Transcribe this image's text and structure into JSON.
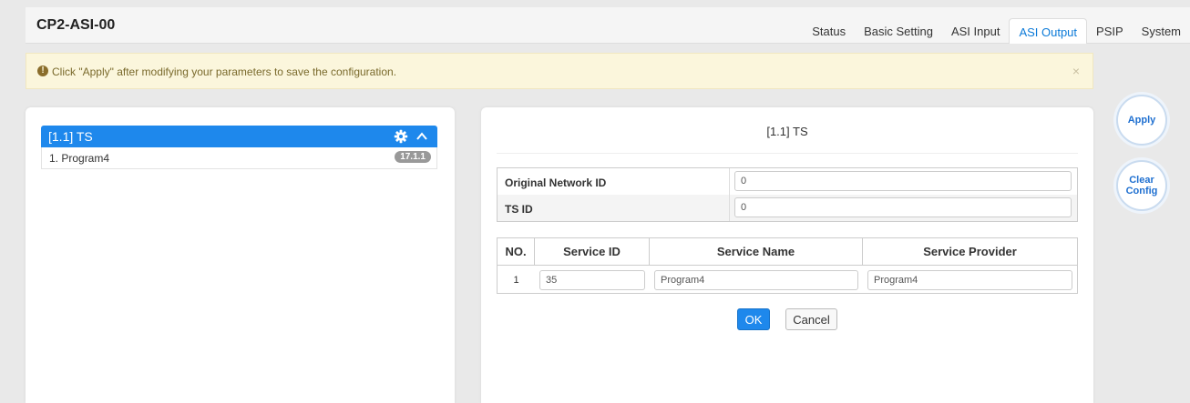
{
  "app": {
    "title": "CP2-ASI-00"
  },
  "tabs": [
    {
      "label": "Status"
    },
    {
      "label": "Basic Setting"
    },
    {
      "label": "ASI Input"
    },
    {
      "label": "ASI Output",
      "active": true
    },
    {
      "label": "PSIP"
    },
    {
      "label": "System"
    }
  ],
  "alert": {
    "icon": "exclamation-circle-icon",
    "text": "Click \"Apply\" after modifying your parameters to save the configuration.",
    "close": "×"
  },
  "tree": {
    "header": "[1.1] TS",
    "items": [
      {
        "label": "1. Program4",
        "badge": "17.1.1"
      }
    ]
  },
  "detail": {
    "title": "[1.1] TS",
    "params": [
      {
        "label": "Original Network ID",
        "value": "0"
      },
      {
        "label": "TS ID",
        "value": "0"
      }
    ],
    "services": {
      "headers": [
        "NO.",
        "Service ID",
        "Service Name",
        "Service Provider"
      ],
      "rows": [
        {
          "no": "1",
          "service_id": "35",
          "service_name": "Program4",
          "service_provider": "Program4"
        }
      ]
    },
    "ok_label": "OK",
    "cancel_label": "Cancel"
  },
  "actions": {
    "apply": "Apply",
    "clear_line1": "Clear",
    "clear_line2": "Config"
  },
  "colors": {
    "accent": "#1e88ec",
    "badge": "#999999",
    "alert_bg": "#fbf6dc"
  }
}
